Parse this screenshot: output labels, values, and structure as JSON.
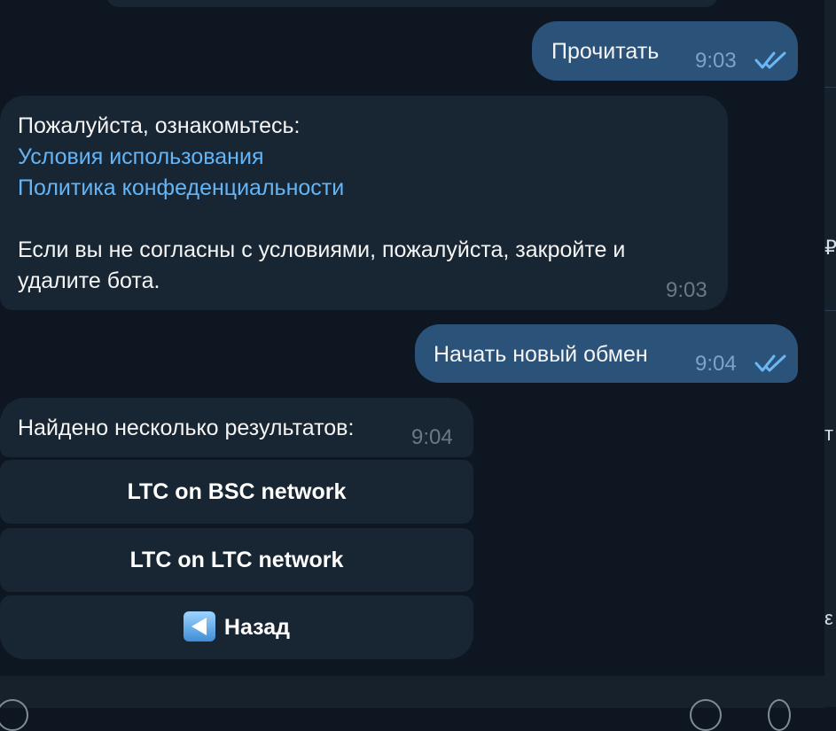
{
  "messages": {
    "read": {
      "text": "Прочитать",
      "time": "9:03"
    },
    "policy": {
      "intro": "Пожалуйста, ознакомьтесь:",
      "links": [
        "Условия использования",
        "Политика конфеденциальности"
      ],
      "body_line1": "Если вы не согласны с условиями, пожалуйста, закройте и",
      "body_line2": "удалите бота.",
      "time": "9:03"
    },
    "new_exchange": {
      "text": "Начать новый обмен",
      "time": "9:04"
    },
    "results": {
      "text": "Найдено несколько результатов:",
      "time": "9:04"
    }
  },
  "inline_buttons": [
    "LTC on BSC network",
    "LTC on LTC network",
    "Назад"
  ],
  "colors": {
    "chat_background": "#0e1621",
    "outgoing_bubble": "#2b5278",
    "incoming_bubble": "#182533",
    "link": "#64b5f6"
  },
  "icons": {
    "delivered": "double-check-icon",
    "back": "back-arrow-icon"
  }
}
